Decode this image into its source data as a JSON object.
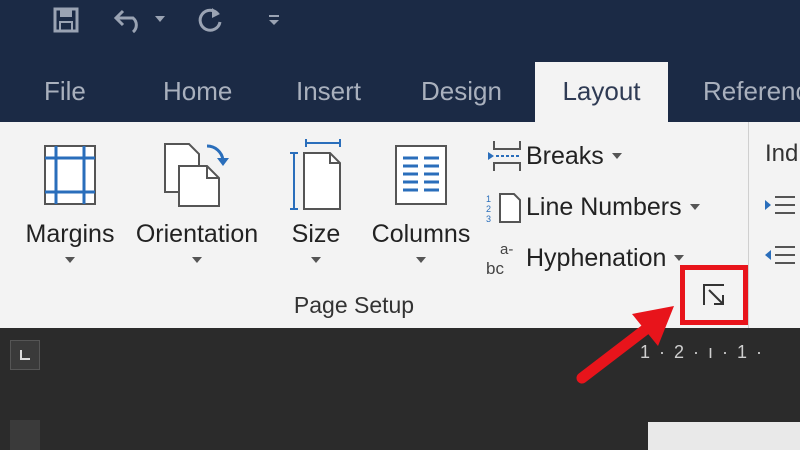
{
  "quick_access": {
    "save_icon": "save-icon",
    "undo_icon": "undo-icon",
    "redo_icon": "redo-icon",
    "customize_icon": "customize-qat-icon"
  },
  "tabs": [
    {
      "label": "File"
    },
    {
      "label": "Home"
    },
    {
      "label": "Insert"
    },
    {
      "label": "Design"
    },
    {
      "label": "Layout"
    },
    {
      "label": "Referenc"
    }
  ],
  "page_setup": {
    "group_label": "Page Setup",
    "margins": "Margins",
    "orientation": "Orientation",
    "size": "Size",
    "columns": "Columns",
    "breaks": "Breaks",
    "line_numbers": "Line Numbers",
    "hyphenation": "Hyphenation"
  },
  "next_group": {
    "indent_label": "Ind"
  },
  "ruler": {
    "text": "1 · 2 · ı · 1 ·"
  },
  "colors": {
    "title_bar": "#1b2a45",
    "ribbon": "#f3f3f3",
    "highlight": "#e8141b",
    "icon_blue": "#2a6ebb"
  }
}
